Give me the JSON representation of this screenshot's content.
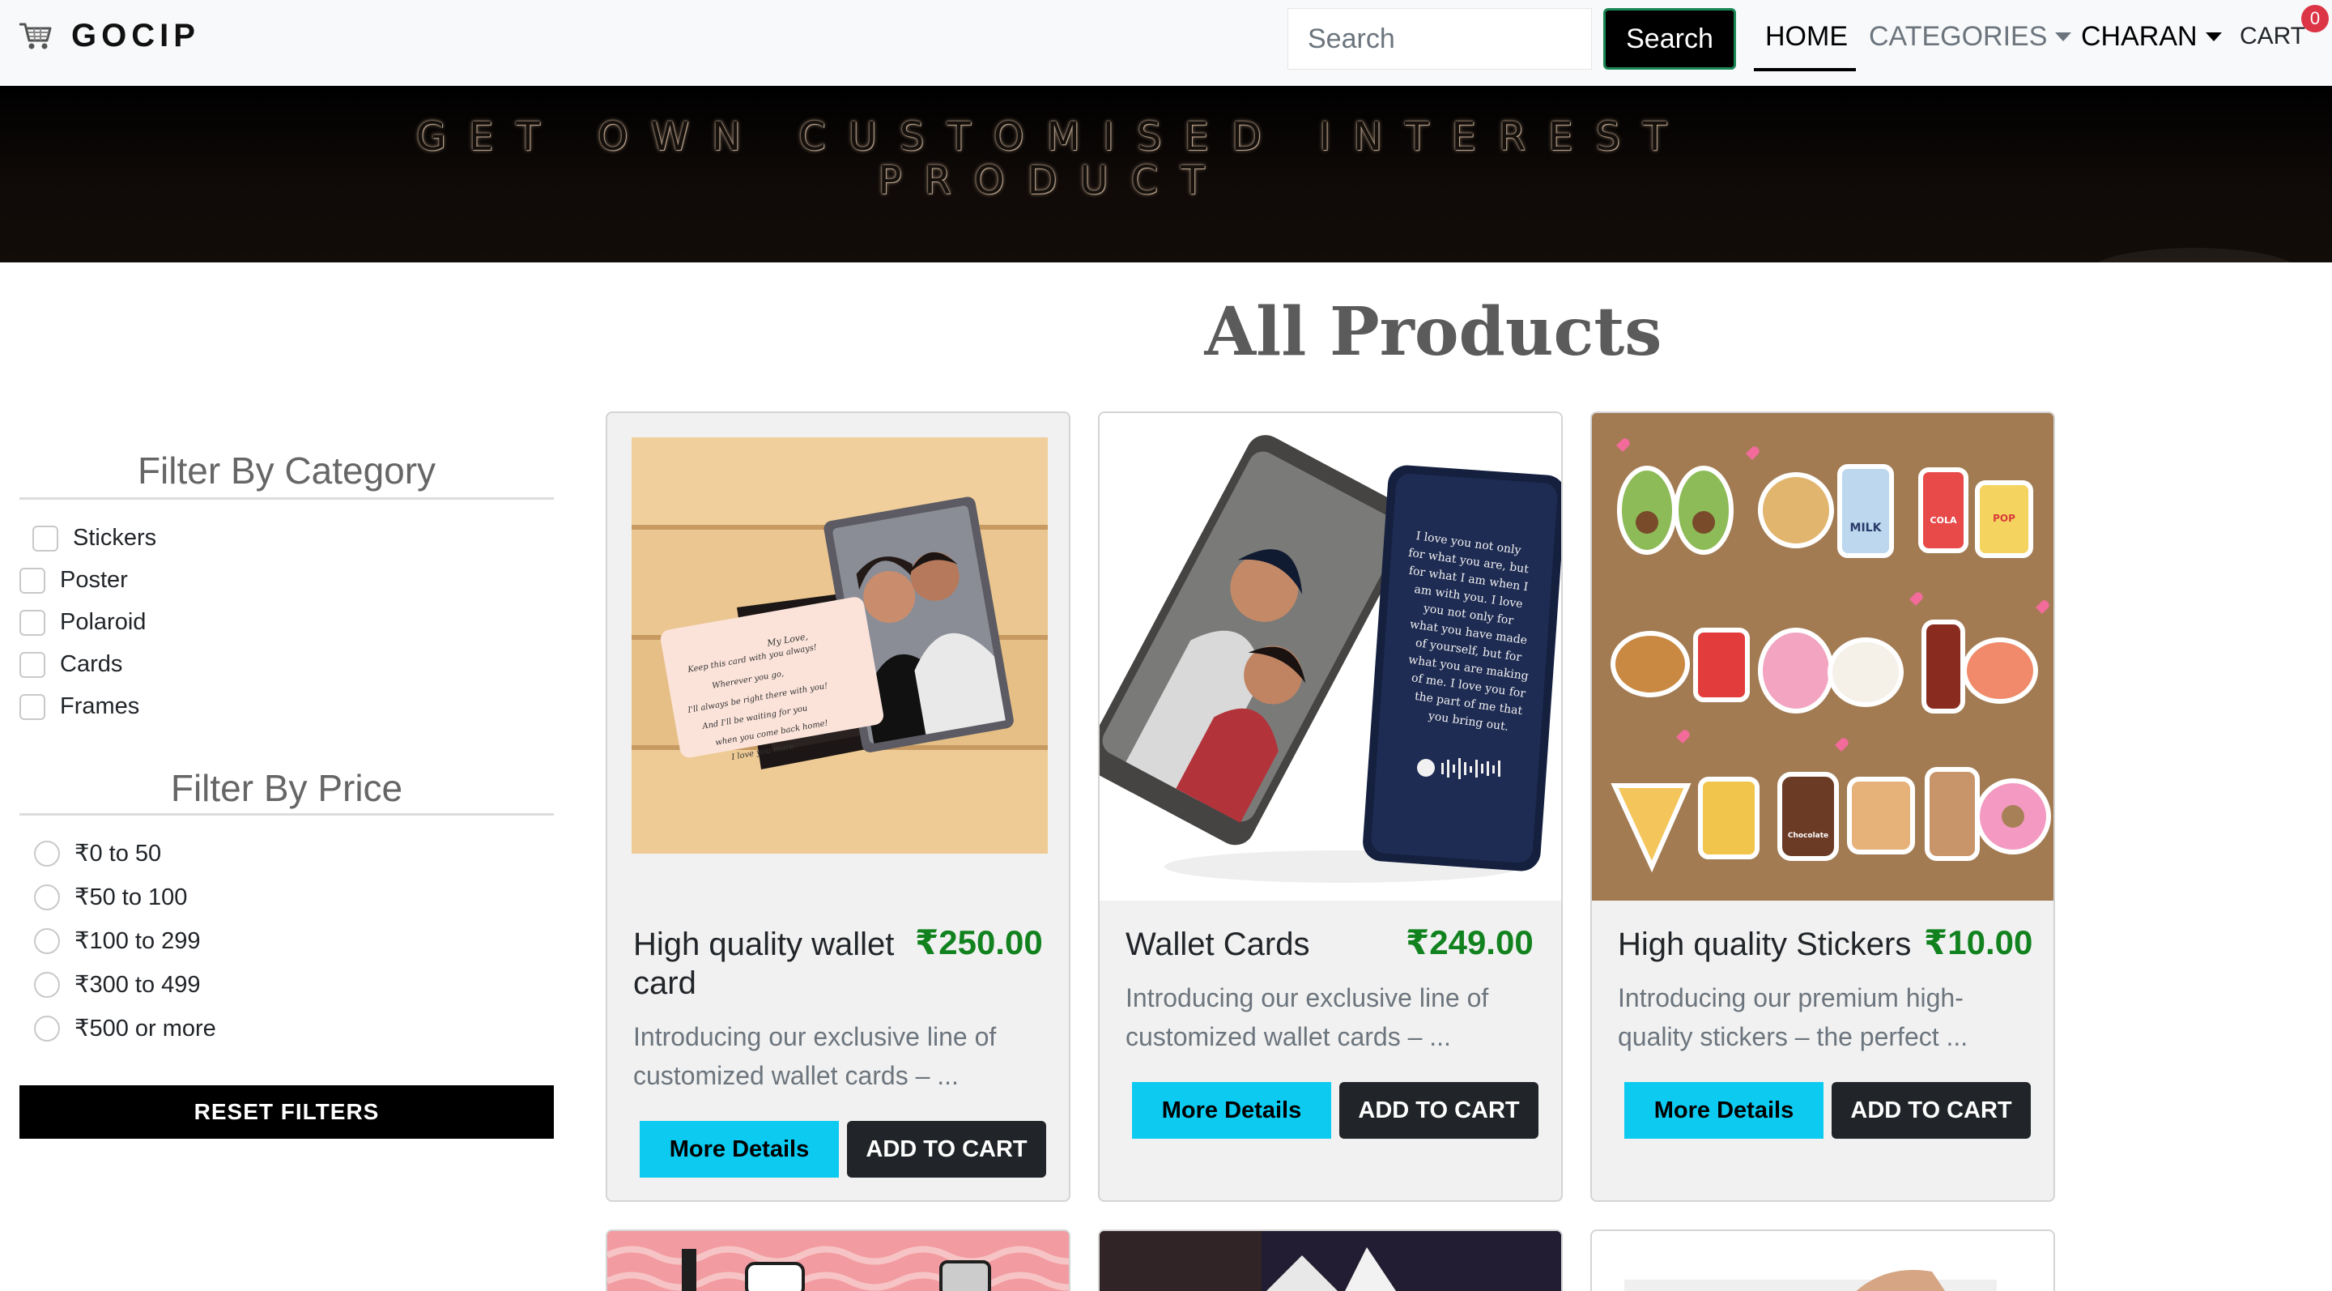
{
  "navbar": {
    "brand": "GOCIP",
    "search_placeholder": "Search",
    "search_button": "Search",
    "links": {
      "home": "HOME",
      "categories": "CATEGORIES",
      "user": "CHARAN",
      "cart": "CART"
    },
    "cart_count": "0"
  },
  "banner": {
    "line1": "GET OWN CUSTOMISED INTEREST",
    "line2": "PRODUCT"
  },
  "main": {
    "title": "All Products"
  },
  "sidebar": {
    "category_title": "Filter By Category",
    "categories": [
      "Stickers",
      "Poster",
      "Polaroid",
      "Cards",
      "Frames"
    ],
    "price_title": "Filter By Price",
    "prices": [
      "₹0 to 50",
      "₹50 to 100",
      "₹100 to 299",
      "₹300 to 499",
      "₹500 or more"
    ],
    "reset": "RESET FILTERS"
  },
  "products": [
    {
      "name": "High quality wallet card",
      "price": "₹250.00",
      "description": "Introducing our exclusive line of customized wallet cards – ...",
      "details_label": "More Details",
      "cart_label": "ADD TO CART"
    },
    {
      "name": "Wallet Cards",
      "price": "₹249.00",
      "description": "Introducing our exclusive line of customized wallet cards – ...",
      "details_label": "More Details",
      "cart_label": "ADD TO CART"
    },
    {
      "name": "High quality Stickers",
      "price": "₹10.00",
      "description": "Introducing our premium high-quality stickers – the perfect ...",
      "details_label": "More Details",
      "cart_label": "ADD TO CART"
    }
  ],
  "images": {
    "wallet_card_note": "My Love, Keep this card with you always! Wherever you go, I'll always be right there with you! And I'll be waiting for you when you come back home! I love you more",
    "wallet_card_back": "I love you not only for what you are, but for what I am when I am with you. I love you not only for what you have made of yourself, but for what you are making of me. I love you for the part of me that you bring out.",
    "sticker_labels": [
      "MILK",
      "COLA",
      "POP",
      "Chocolate"
    ]
  },
  "colors": {
    "accent": "#0dcaf0",
    "price": "#12821f",
    "badge": "#dc3545",
    "dark": "#212529"
  }
}
